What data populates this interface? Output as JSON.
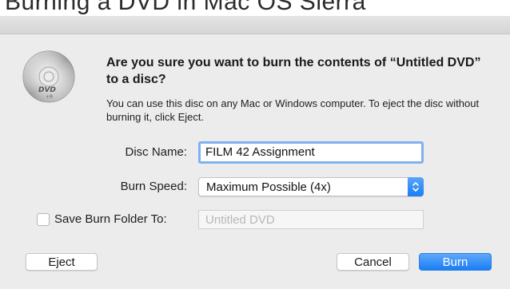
{
  "backdrop": {
    "text": "Burning a DVD in Mac OS Sierra"
  },
  "dialog": {
    "icon": "dvd-disc-icon",
    "icon_label": "DVD",
    "icon_sublabel": "+R",
    "headline": "Are you sure you want to burn the contents of “Untitled DVD” to a disc?",
    "body": "You can use this disc on any Mac or Windows computer. To eject the disc without burning it, click Eject.",
    "disc_name": {
      "label": "Disc Name:",
      "value": "FILM 42 Assignment"
    },
    "burn_speed": {
      "label": "Burn Speed:",
      "selected": "Maximum Possible (4x)"
    },
    "save_burn_folder": {
      "label": "Save Burn Folder To:",
      "checked": false,
      "placeholder": "Untitled DVD"
    },
    "buttons": {
      "eject": "Eject",
      "cancel": "Cancel",
      "burn": "Burn"
    }
  },
  "colors": {
    "accent": "#1a7ef4",
    "focus_ring": "#80b1ee",
    "sheet_background": "#ececec"
  }
}
